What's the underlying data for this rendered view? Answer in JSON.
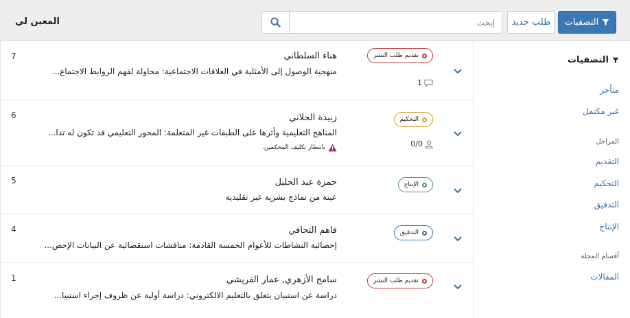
{
  "header": {
    "title": "المعين لي",
    "filters_label": "التصفيات",
    "new_label": "طلب جديد",
    "search_placeholder": "إبحث"
  },
  "sidebar": {
    "title": "التصفيات",
    "quick": [
      "متأخر",
      "غير مكتمل"
    ],
    "stages_heading": "المراحل",
    "stages": [
      "التقديم",
      "التحكيم",
      "التدقيق",
      "الإنتاج"
    ],
    "sections_heading": "أقسام المجلة",
    "sections": [
      "المقالات"
    ]
  },
  "submissions": [
    {
      "id": "7",
      "author": "هناء السلطاني",
      "title": "منهجية الوصول إلى الأمثلية في العلاقات الاجتماعية: محاولة لفهم الروابط الاجتماع...",
      "stage": "تقديم طلب النشر",
      "stage_color": "#c23b3b",
      "meta_icon": "comment-icon",
      "meta": "1",
      "warning": ""
    },
    {
      "id": "6",
      "author": "زبيدة الحلاني",
      "title": "المناهج التعليمية وأثرها على الطبقات غير المتعلمة: المحور التعليمي قد تكون له تدا...",
      "stage": "التحكيم",
      "stage_color": "#d29b2a",
      "meta_icon": "user-icon",
      "meta": "0/0",
      "warning": "بانتظار تكليف المحكمين."
    },
    {
      "id": "5",
      "author": "حمزة عبد الجليل",
      "title": "عينة من نماذج بشرية غير تقليدية",
      "stage": "الإنتاج",
      "stage_color": "#3f9a6a",
      "meta_icon": "",
      "meta": "",
      "warning": ""
    },
    {
      "id": "4",
      "author": "فاهم التحافي",
      "title": "إحصائية النشاطات للأعوام الخمسة القادمة: مناقشات استقصائية عن البيانات الإحص...",
      "stage": "التدقيق",
      "stage_color": "#3a6ea5",
      "meta_icon": "",
      "meta": "",
      "warning": ""
    },
    {
      "id": "1",
      "author": "سامح الأزهري, عمار القريشي",
      "title": "دراسة عن استبيان يتعلق بالتعليم الالكتروني: دراسة أولية عن ظروف إجراء استبيا...",
      "stage": "تقديم طلب النشر",
      "stage_color": "#c23b3b",
      "meta_icon": "",
      "meta": "",
      "warning": ""
    }
  ],
  "colors": {
    "primary": "#3a78b5",
    "link": "#3a6ea5",
    "warning": "#9b2c6e"
  }
}
